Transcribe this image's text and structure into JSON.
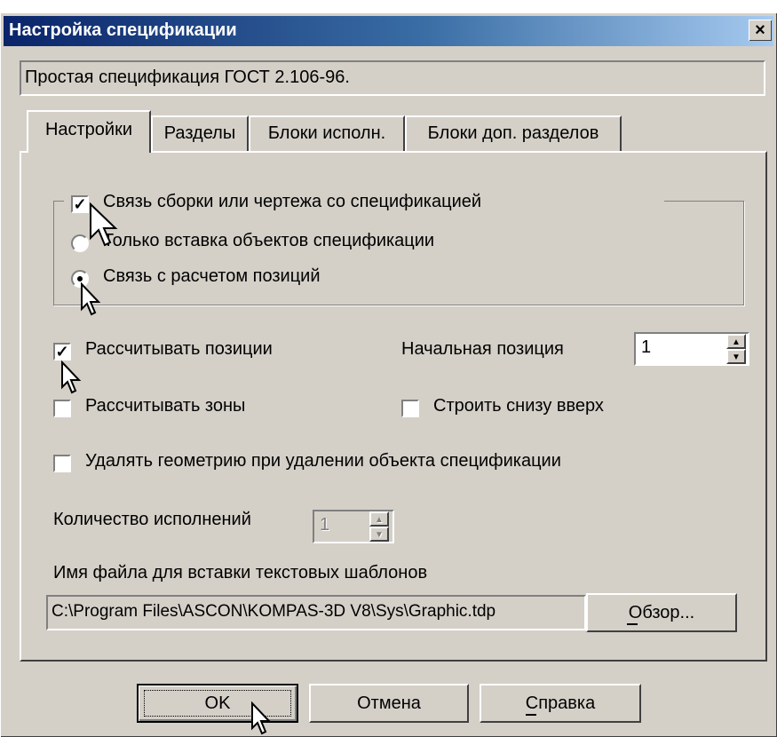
{
  "window": {
    "title": "Настройка спецификации",
    "close_label": "×"
  },
  "spec_name": "Простая спецификация ГОСТ 2.106-96.",
  "tabs": [
    {
      "label": "Настройки",
      "active": true
    },
    {
      "label": "Разделы",
      "active": false
    },
    {
      "label": "Блоки исполн.",
      "active": false
    },
    {
      "label": "Блоки доп. разделов",
      "active": false
    }
  ],
  "link_group": {
    "checkbox_label": "Связь сборки или чертежа со спецификацией",
    "checkbox_checked": true,
    "radio_insert_label": "Только вставка объектов спецификации",
    "radio_insert_selected": false,
    "radio_calc_label": "Связь с расчетом позиций",
    "radio_calc_selected": true
  },
  "options": {
    "calc_positions_label": "Рассчитывать позиции",
    "calc_positions_checked": true,
    "start_position_label": "Начальная позиция",
    "start_position_value": "1",
    "calc_zones_label": "Рассчитывать зоны",
    "calc_zones_checked": false,
    "build_bottom_up_label": "Строить снизу вверх",
    "build_bottom_up_checked": false,
    "delete_geometry_label": "Удалять геометрию при удалении объекта спецификации",
    "delete_geometry_checked": false,
    "variants_count_label": "Количество исполнений",
    "variants_count_value": "1",
    "template_file_label": "Имя файла для вставки текстовых шаблонов",
    "template_file_value": "C:\\Program Files\\ASCON\\KOMPAS-3D V8\\Sys\\Graphic.tdp",
    "browse_label": "Обзор..."
  },
  "buttons": {
    "ok": "OK",
    "cancel": "Отмена",
    "help": "Справка"
  },
  "colors": {
    "dialog_face": "#d4d0c8",
    "titlebar_start": "#0a246a",
    "titlebar_end": "#a6caf0"
  }
}
